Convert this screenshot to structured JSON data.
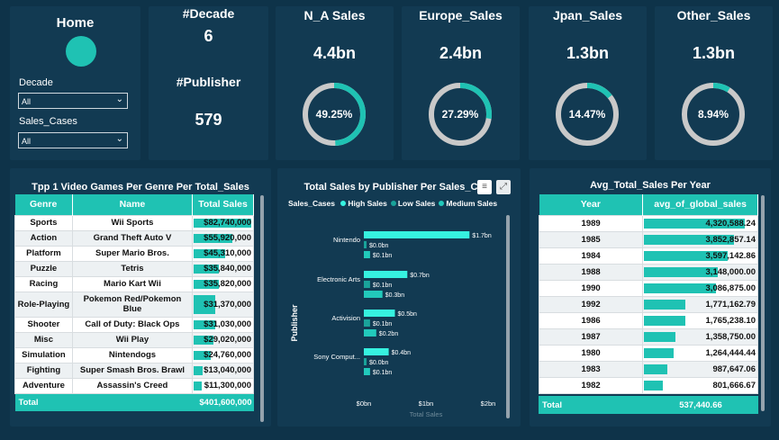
{
  "home": {
    "title": "Home",
    "decade_label": "Decade",
    "decade_value": "All",
    "sales_cases_label": "Sales_Cases",
    "sales_cases_value": "All"
  },
  "counts": {
    "decade_title": "#Decade",
    "decade_value": "6",
    "publisher_title": "#Publisher",
    "publisher_value": "579"
  },
  "metrics": [
    {
      "title": "N_A Sales",
      "value": "4.4bn",
      "percent_label": "49.25%",
      "percent": 49.25
    },
    {
      "title": "Europe_Sales",
      "value": "2.4bn",
      "percent_label": "27.29%",
      "percent": 27.29
    },
    {
      "title": "Jpan_Sales",
      "value": "1.3bn",
      "percent_label": "14.47%",
      "percent": 14.47
    },
    {
      "title": "Other_Sales",
      "value": "1.3bn",
      "percent_label": "8.94%",
      "percent": 8.94
    }
  ],
  "genre_table": {
    "title": "Tpp 1 Video Games Per Genre Per Total_Sales",
    "columns": [
      "Genre",
      "Name",
      "Total Sales"
    ],
    "rows": [
      {
        "genre": "Sports",
        "name": "Wii Sports",
        "sales": "$82,740,000",
        "value": 82740000
      },
      {
        "genre": "Action",
        "name": "Grand Theft Auto V",
        "sales": "$55,920,000",
        "value": 55920000
      },
      {
        "genre": "Platform",
        "name": "Super Mario Bros.",
        "sales": "$45,310,000",
        "value": 45310000
      },
      {
        "genre": "Puzzle",
        "name": "Tetris",
        "sales": "$35,840,000",
        "value": 35840000
      },
      {
        "genre": "Racing",
        "name": "Mario Kart Wii",
        "sales": "$35,820,000",
        "value": 35820000
      },
      {
        "genre": "Role-Playing",
        "name": "Pokemon Red/Pokemon Blue",
        "sales": "$31,370,000",
        "value": 31370000
      },
      {
        "genre": "Shooter",
        "name": "Call of Duty: Black Ops",
        "sales": "$31,030,000",
        "value": 31030000
      },
      {
        "genre": "Misc",
        "name": "Wii Play",
        "sales": "$29,020,000",
        "value": 29020000
      },
      {
        "genre": "Simulation",
        "name": "Nintendogs",
        "sales": "$24,760,000",
        "value": 24760000
      },
      {
        "genre": "Fighting",
        "name": "Super Smash Bros. Brawl",
        "sales": "$13,040,000",
        "value": 13040000
      },
      {
        "genre": "Adventure",
        "name": "Assassin's Creed",
        "sales": "$11,300,000",
        "value": 11300000
      }
    ],
    "total_label": "Total",
    "total_value": "$401,600,000",
    "max_value": 82740000
  },
  "publisher_chart": {
    "title": "Total Sales by Publisher Per Sales_Ca",
    "legend_title": "Sales_Cases",
    "legend": [
      {
        "name": "High Sales",
        "color": "#36f2e0"
      },
      {
        "name": "Low Sales",
        "color": "#1aa39a"
      },
      {
        "name": "Medium Sales",
        "color": "#22c9bb"
      }
    ],
    "ylabel": "Publisher",
    "xlabel": "Total Sales",
    "x_ticks": [
      "$0bn",
      "$1bn",
      "$2bn"
    ],
    "filter_icon": "filter-icon",
    "expand_icon": "expand-icon"
  },
  "chart_data": {
    "type": "bar",
    "title": "Total Sales by Publisher Per Sales_Ca",
    "categories": [
      "Nintendo",
      "Electronic Arts",
      "Activision",
      "Sony Comput..."
    ],
    "series": [
      {
        "name": "High Sales",
        "values": [
          1.7,
          0.7,
          0.5,
          0.4
        ],
        "labels": [
          "$1.7bn",
          "$0.7bn",
          "$0.5bn",
          "$0.4bn"
        ]
      },
      {
        "name": "Low Sales",
        "values": [
          0.0,
          0.1,
          0.1,
          0.0
        ],
        "labels": [
          "$0.0bn",
          "$0.1bn",
          "$0.1bn",
          "$0.0bn"
        ]
      },
      {
        "name": "Medium Sales",
        "values": [
          0.1,
          0.3,
          0.2,
          0.1
        ],
        "labels": [
          "$0.1bn",
          "$0.3bn",
          "$0.2bn",
          "$0.1bn"
        ]
      }
    ],
    "xlim": [
      0,
      2
    ],
    "orientation": "horizontal",
    "ylabel": "Publisher",
    "xlabel": "Total Sales"
  },
  "year_table": {
    "title": "Avg_Total_Sales Per Year",
    "columns": [
      "Year",
      "avg_of_global_sales"
    ],
    "rows": [
      {
        "year": "1989",
        "avg": "4,320,588.24",
        "value": 4320588.24
      },
      {
        "year": "1985",
        "avg": "3,852,857.14",
        "value": 3852857.14
      },
      {
        "year": "1984",
        "avg": "3,597,142.86",
        "value": 3597142.86
      },
      {
        "year": "1988",
        "avg": "3,148,000.00",
        "value": 3148000.0
      },
      {
        "year": "1990",
        "avg": "3,086,875.00",
        "value": 3086875.0
      },
      {
        "year": "1992",
        "avg": "1,771,162.79",
        "value": 1771162.79
      },
      {
        "year": "1986",
        "avg": "1,765,238.10",
        "value": 1765238.1
      },
      {
        "year": "1987",
        "avg": "1,358,750.00",
        "value": 1358750.0
      },
      {
        "year": "1980",
        "avg": "1,264,444.44",
        "value": 1264444.44
      },
      {
        "year": "1983",
        "avg": "987,647.06",
        "value": 987647.06
      },
      {
        "year": "1982",
        "avg": "801,666.67",
        "value": 801666.67
      }
    ],
    "total_label": "Total",
    "total_value": "537,440.66",
    "max_value": 4320588.24
  }
}
